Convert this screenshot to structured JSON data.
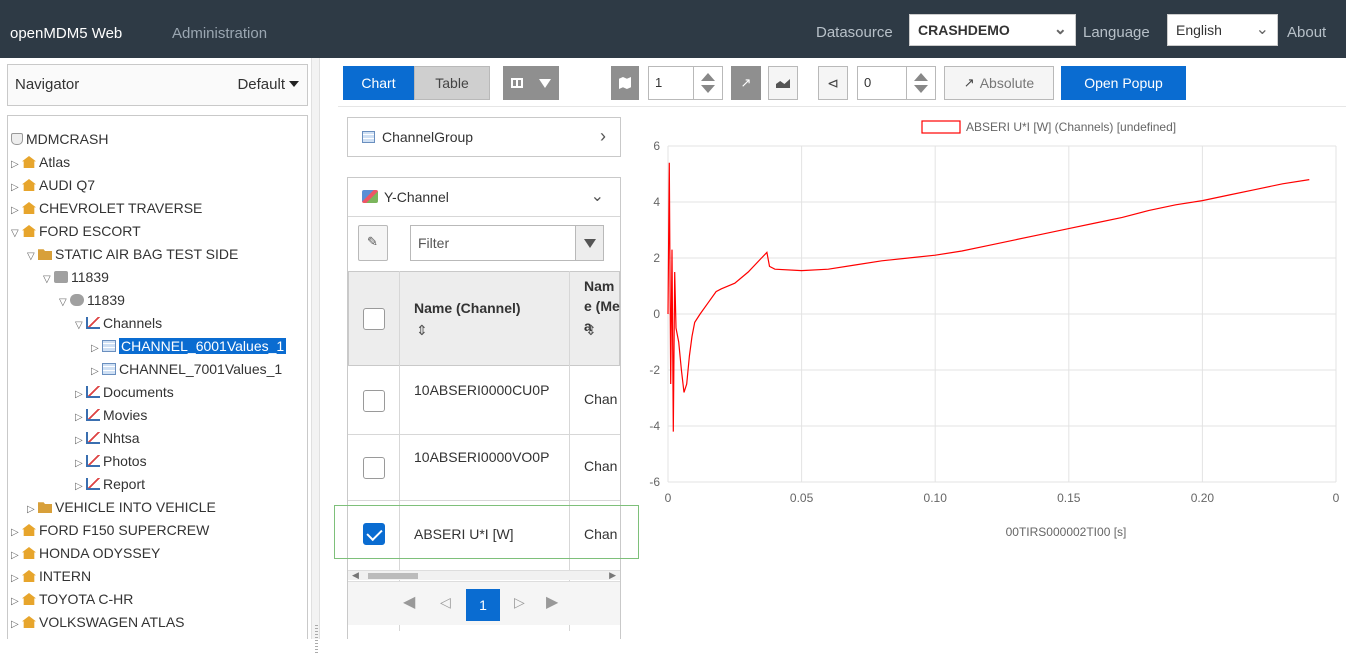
{
  "topbar": {
    "brand": "openMDM5 Web",
    "admin": "Administration",
    "datasource_label": "Datasource",
    "datasource_value": "CRASHDEMO",
    "language_label": "Language",
    "language_value": "English",
    "about": "About"
  },
  "navigator": {
    "title": "Navigator",
    "dropdown_value": "Default",
    "tree": [
      {
        "label": "MDMCRASH",
        "icon": "database-icon"
      },
      {
        "label": "Atlas",
        "icon": "house-icon"
      },
      {
        "label": "AUDI Q7",
        "icon": "house-icon"
      },
      {
        "label": "CHEVROLET TRAVERSE",
        "icon": "house-icon"
      },
      {
        "label": "FORD ESCORT",
        "icon": "house-icon"
      },
      {
        "label": "STATIC AIR BAG TEST SIDE",
        "icon": "folder-icon"
      },
      {
        "label": "11839",
        "icon": "test-icon"
      },
      {
        "label": "11839",
        "icon": "teststep-icon"
      },
      {
        "label": "Channels",
        "icon": "chart-icon"
      },
      {
        "label": "CHANNEL_6001Values_1",
        "icon": "table-icon"
      },
      {
        "label": "CHANNEL_7001Values_1",
        "icon": "table-icon"
      },
      {
        "label": "Documents",
        "icon": "chart-icon"
      },
      {
        "label": "Movies",
        "icon": "chart-icon"
      },
      {
        "label": "Nhtsa",
        "icon": "chart-icon"
      },
      {
        "label": "Photos",
        "icon": "chart-icon"
      },
      {
        "label": "Report",
        "icon": "chart-icon"
      },
      {
        "label": "VEHICLE INTO VEHICLE",
        "icon": "folder-icon"
      },
      {
        "label": "FORD F150 SUPERCREW",
        "icon": "house-icon"
      },
      {
        "label": "HONDA ODYSSEY",
        "icon": "house-icon"
      },
      {
        "label": "INTERN",
        "icon": "house-icon"
      },
      {
        "label": "TOYOTA C-HR",
        "icon": "house-icon"
      },
      {
        "label": "VOLKSWAGEN ATLAS",
        "icon": "house-icon"
      }
    ]
  },
  "toolbar": {
    "chart_tab": "Chart",
    "table_tab": "Table",
    "value_1": "1",
    "value_2": "0",
    "absolute_label": "Absolute",
    "open_popup": "Open Popup"
  },
  "channel_group": {
    "label": "ChannelGroup"
  },
  "y_channel": {
    "label": "Y-Channel",
    "filter_placeholder": "Filter",
    "columns": [
      "Name (Channel)",
      "Name (Mea"
    ],
    "rows": [
      {
        "name": "10ABSERI0000CU0P",
        "meas": "Chan",
        "checked": false
      },
      {
        "name": "10ABSERI0000VO0P",
        "meas": "Chan",
        "checked": false
      },
      {
        "name": "ABSERI U*I [W]",
        "meas": "Chan",
        "checked": true
      }
    ],
    "page": "1"
  },
  "chart_data": {
    "type": "line",
    "legend": "ABSERI U*I [W] (Channels) [undefined]",
    "xlabel": "00TIRS000002TI00 [s]",
    "ylabel": "",
    "xlim": [
      0,
      0.25
    ],
    "ylim": [
      -6,
      6
    ],
    "x_ticks": [
      "0",
      "0.05",
      "0.10",
      "0.15",
      "0.20",
      "0"
    ],
    "y_ticks": [
      "6",
      "4",
      "2",
      "0",
      "-2",
      "-4",
      "-6"
    ],
    "color": "#ff0000",
    "series": [
      {
        "name": "ABSERI U*I [W] (Channels) [undefined]",
        "x": [
          0.0,
          0.0005,
          0.001,
          0.0015,
          0.002,
          0.0025,
          0.003,
          0.004,
          0.005,
          0.006,
          0.007,
          0.008,
          0.009,
          0.01,
          0.012,
          0.015,
          0.018,
          0.02,
          0.025,
          0.03,
          0.035,
          0.037,
          0.038,
          0.04,
          0.05,
          0.06,
          0.07,
          0.08,
          0.09,
          0.1,
          0.11,
          0.12,
          0.13,
          0.14,
          0.15,
          0.16,
          0.17,
          0.18,
          0.19,
          0.2,
          0.21,
          0.22,
          0.23,
          0.24
        ],
        "y": [
          0.0,
          5.4,
          -2.5,
          2.3,
          -4.2,
          1.5,
          -0.5,
          -1.0,
          -2.0,
          -2.8,
          -2.5,
          -1.5,
          -0.8,
          -0.3,
          0.0,
          0.4,
          0.8,
          0.9,
          1.1,
          1.5,
          2.0,
          2.2,
          1.7,
          1.6,
          1.55,
          1.6,
          1.75,
          1.9,
          2.0,
          2.1,
          2.25,
          2.45,
          2.65,
          2.85,
          3.05,
          3.25,
          3.45,
          3.7,
          3.9,
          4.05,
          4.25,
          4.45,
          4.65,
          4.8
        ]
      }
    ]
  }
}
